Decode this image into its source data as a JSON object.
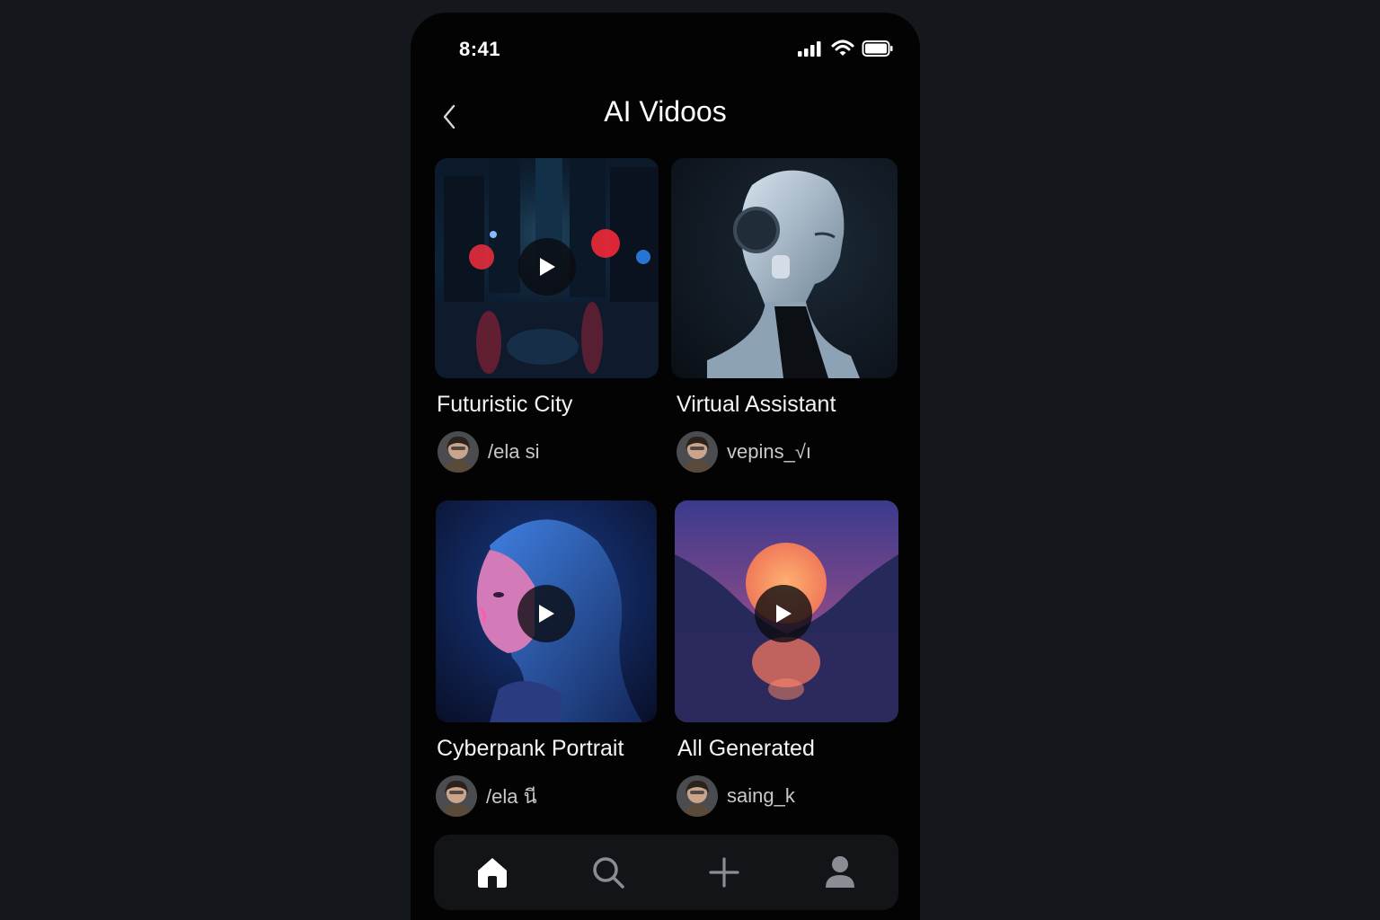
{
  "status_bar": {
    "time": "8:41",
    "icons": [
      "signal-icon",
      "wifi-icon",
      "battery-icon"
    ]
  },
  "header": {
    "title": "AI Vidoos",
    "back_icon": "chevron-left-icon"
  },
  "videos": [
    {
      "title": "Futuristic City",
      "author": "/ela si",
      "has_play_button": true
    },
    {
      "title": "Virtual Assistant",
      "author": "vepins_√ı",
      "has_play_button": false
    },
    {
      "title": "Cyberpank Portrait",
      "author": "/ela นี",
      "has_play_button": true
    },
    {
      "title": "All Generated",
      "author": "saing_k",
      "has_play_button": true
    }
  ],
  "bottom_nav": {
    "items": [
      {
        "icon": "home-icon",
        "active": true
      },
      {
        "icon": "search-icon",
        "active": false
      },
      {
        "icon": "plus-icon",
        "active": false
      },
      {
        "icon": "profile-icon",
        "active": false
      }
    ]
  },
  "colors": {
    "background": "#14171c",
    "phone": "#030304",
    "nav_bar": "#131418",
    "text_primary": "#ffffff",
    "text_secondary": "#c9c9cc",
    "icon_inactive": "#8a8d94"
  }
}
